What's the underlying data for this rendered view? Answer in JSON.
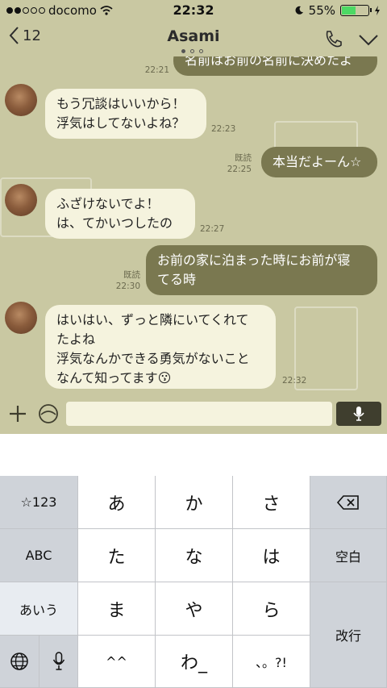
{
  "status": {
    "carrier": "docomo",
    "time": "22:32",
    "battery": "55%",
    "battery_level": 0.55
  },
  "header": {
    "back_count": "12",
    "title": "Asami"
  },
  "messages": [
    {
      "dir": "out",
      "text": "名前はお前の名前に決めたよ",
      "time": "22:21"
    },
    {
      "dir": "in",
      "text": "もう冗談はいいから！\n浮気はしてないよね？",
      "time": "22:23"
    },
    {
      "dir": "out",
      "text": "本当だよーん☆",
      "read": "既読",
      "time": "22:25"
    },
    {
      "dir": "in",
      "text": "ふざけないでよ！\nは、てかいつしたの",
      "time": "22:27"
    },
    {
      "dir": "out",
      "text": "お前の家に泊まった時にお前が寝\nてる時",
      "read": "既読",
      "time": "22:30"
    },
    {
      "dir": "in",
      "text": "はいはい、ずっと隣にいてくれて\nたよね\n浮気なんかできる勇気がないこと\nなんて知ってます😗",
      "time": "22:32"
    }
  ],
  "keyboard": {
    "rows": [
      [
        "☆123",
        "あ",
        "か",
        "さ",
        "⌫"
      ],
      [
        "ABC",
        "た",
        "な",
        "は",
        "空白"
      ],
      [
        "あいう",
        "ま",
        "や",
        "ら",
        "改行"
      ],
      [
        "globe",
        "mic",
        "^^",
        "わ_",
        "、。?!"
      ]
    ]
  },
  "colors": {
    "chat_bg": "#c9c8a2",
    "bubble_in": "#f5f3de",
    "bubble_out": "#7a7850",
    "battery": "#4cd964"
  }
}
